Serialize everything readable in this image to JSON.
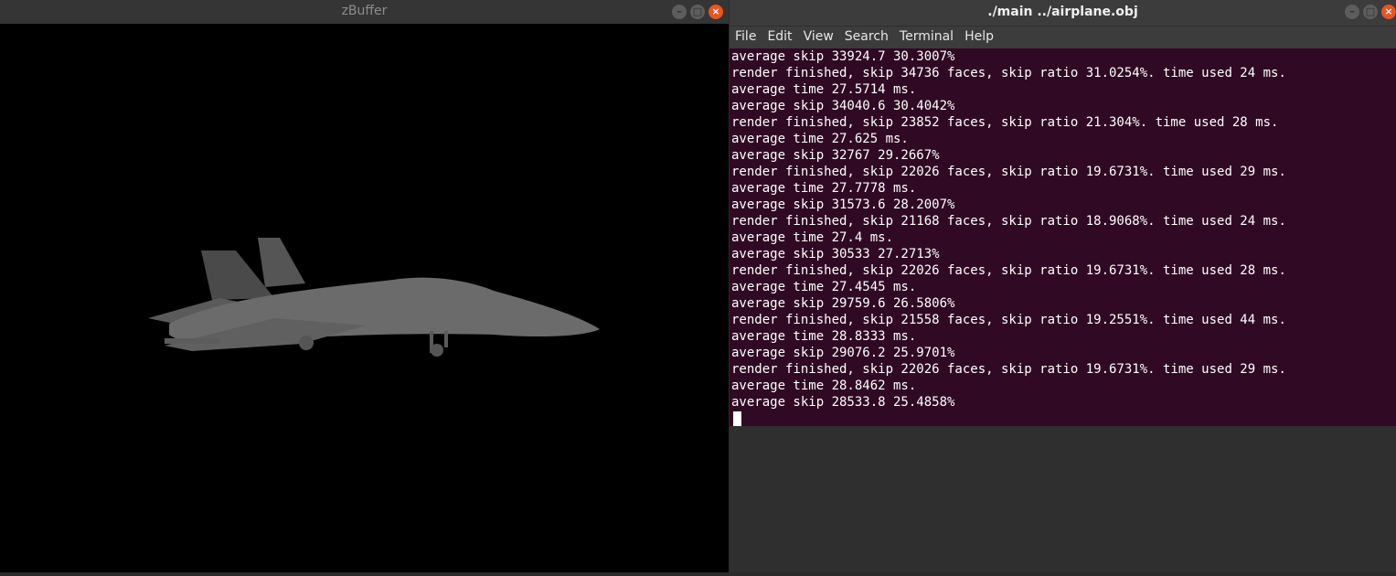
{
  "left_window": {
    "title": "zBuffer",
    "buttons": {
      "minimize": "–",
      "maximize": "□",
      "close": "×"
    }
  },
  "right_window": {
    "title": "./main ../airplane.obj",
    "buttons": {
      "minimize": "–",
      "maximize": "□",
      "close": "×"
    },
    "menu": [
      "File",
      "Edit",
      "View",
      "Search",
      "Terminal",
      "Help"
    ],
    "terminal_lines": [
      "average skip 33924.7 30.3007%",
      "render finished, skip 34736 faces, skip ratio 31.0254%. time used 24 ms.",
      "average time 27.5714 ms.",
      "average skip 34040.6 30.4042%",
      "render finished, skip 23852 faces, skip ratio 21.304%. time used 28 ms.",
      "average time 27.625 ms.",
      "average skip 32767 29.2667%",
      "render finished, skip 22026 faces, skip ratio 19.6731%. time used 29 ms.",
      "average time 27.7778 ms.",
      "average skip 31573.6 28.2007%",
      "render finished, skip 21168 faces, skip ratio 18.9068%. time used 24 ms.",
      "average time 27.4 ms.",
      "average skip 30533 27.2713%",
      "render finished, skip 22026 faces, skip ratio 19.6731%. time used 28 ms.",
      "average time 27.4545 ms.",
      "average skip 29759.6 26.5806%",
      "render finished, skip 21558 faces, skip ratio 19.2551%. time used 44 ms.",
      "average time 28.8333 ms.",
      "average skip 29076.2 25.9701%",
      "render finished, skip 22026 faces, skip ratio 19.6731%. time used 29 ms.",
      "average time 28.8462 ms.",
      "average skip 28533.8 25.4858%"
    ]
  },
  "colors": {
    "terminal_bg": "#300a24",
    "close_button": "#e95420"
  }
}
